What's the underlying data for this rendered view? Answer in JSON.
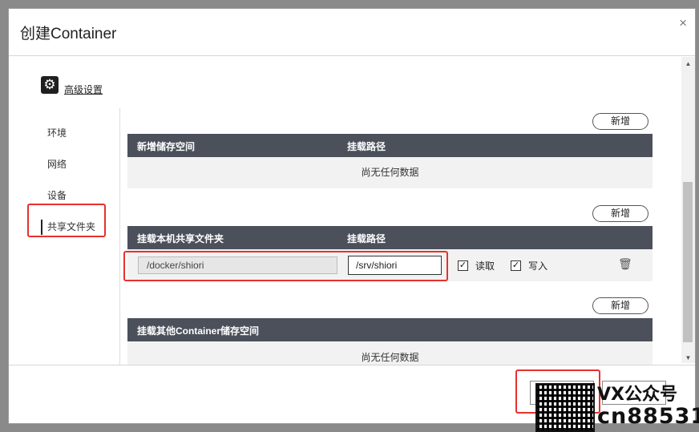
{
  "dialog": {
    "title": "创建Container",
    "close_icon": "×"
  },
  "advanced": {
    "label": "高级设置",
    "icon": "gear-icon"
  },
  "nav": {
    "items": [
      {
        "label": "环境"
      },
      {
        "label": "网络"
      },
      {
        "label": "设备"
      },
      {
        "label": "共享文件夹",
        "active": true
      }
    ]
  },
  "section1": {
    "add_label": "新增",
    "col1": "新增储存空间",
    "col2": "挂载路径",
    "empty_text": "尚无任何数据"
  },
  "section2": {
    "add_label": "新增",
    "col1": "挂载本机共享文件夹",
    "col2": "挂载路径",
    "row": {
      "host_path": "/docker/shiori",
      "mount_path": "/srv/shiori",
      "read_label": "读取",
      "read_checked": true,
      "write_label": "写入",
      "write_checked": true,
      "delete_icon": "trash-icon"
    }
  },
  "section3": {
    "add_label": "新增",
    "col1": "挂载其他Container储存空间",
    "empty_text": "尚无任何数据"
  },
  "watermark": {
    "line1": "VX公众号",
    "line2": "cn88531"
  },
  "colors": {
    "header_bg": "#4b505b",
    "highlight": "#e5322d"
  }
}
